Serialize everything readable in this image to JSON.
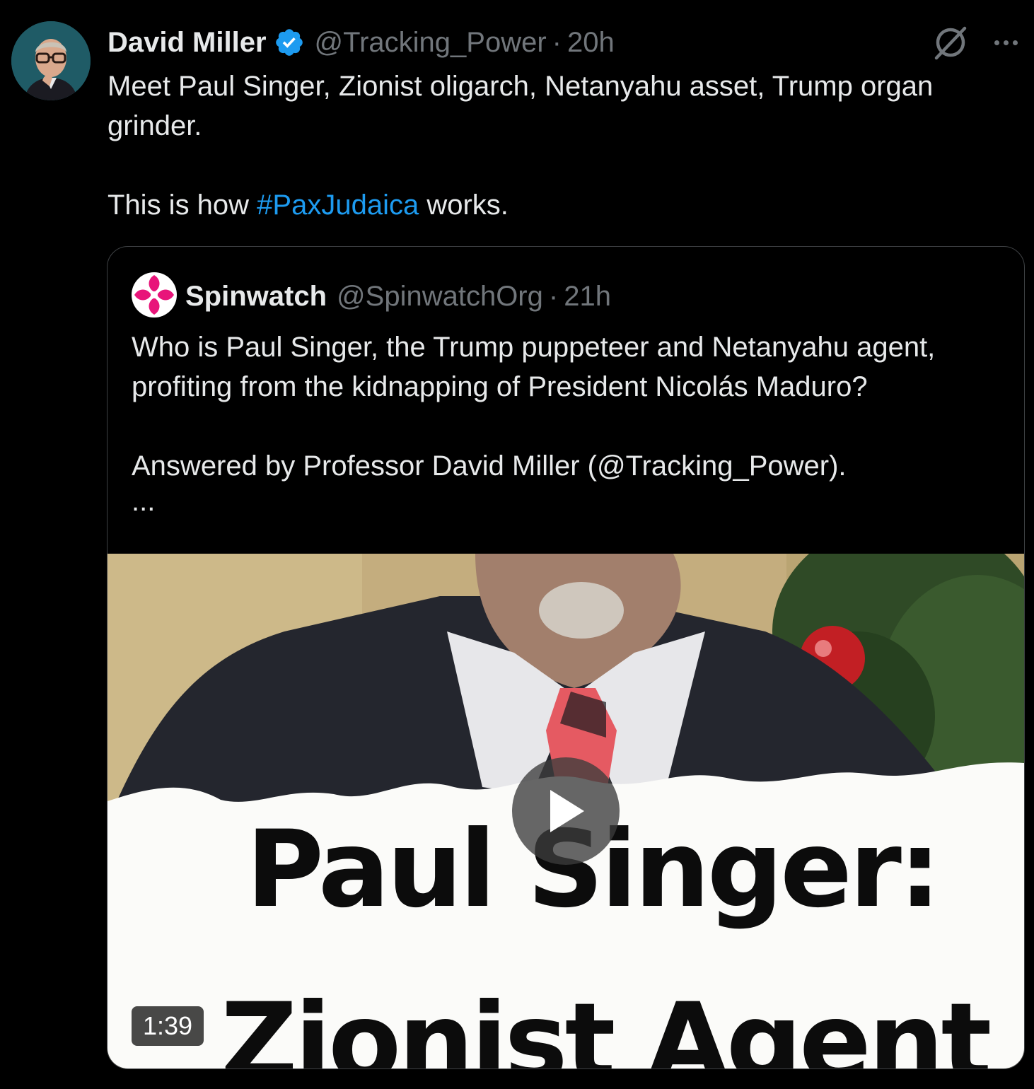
{
  "post": {
    "author": {
      "display_name": "David Miller",
      "handle": "@Tracking_Power",
      "time": "20h",
      "separator": "·",
      "verified": true
    },
    "text_line1": "Meet Paul Singer, Zionist oligarch, Netanyahu asset, Trump organ grinder.",
    "text_line2_before": "This is how ",
    "hashtag": "#PaxJudaica",
    "text_line2_after": " works."
  },
  "quote": {
    "author": {
      "display_name": "Spinwatch",
      "handle": "@SpinwatchOrg",
      "time": "21h",
      "separator": "·"
    },
    "text_para1": "Who is Paul Singer, the Trump puppeteer and Netanyahu agent, profiting from the kidnapping of President Nicolás Maduro?",
    "text_para2": "Answered by Professor David Miller (@Tracking_Power).",
    "truncation": "...",
    "media": {
      "type": "video",
      "caption_line1": "Paul Singer:",
      "caption_line2": "Zionist Agent",
      "duration": "1:39"
    }
  },
  "icons": {
    "verified": "verified-badge-icon",
    "grok": "grok-icon",
    "more": "more-options-icon",
    "play": "play-icon"
  },
  "colors": {
    "background": "#000000",
    "text_primary": "#e7e9ea",
    "text_secondary": "#71767b",
    "link": "#1d9bf0",
    "verified": "#1d9bf0",
    "spinwatch_brand": "#e8157a"
  }
}
